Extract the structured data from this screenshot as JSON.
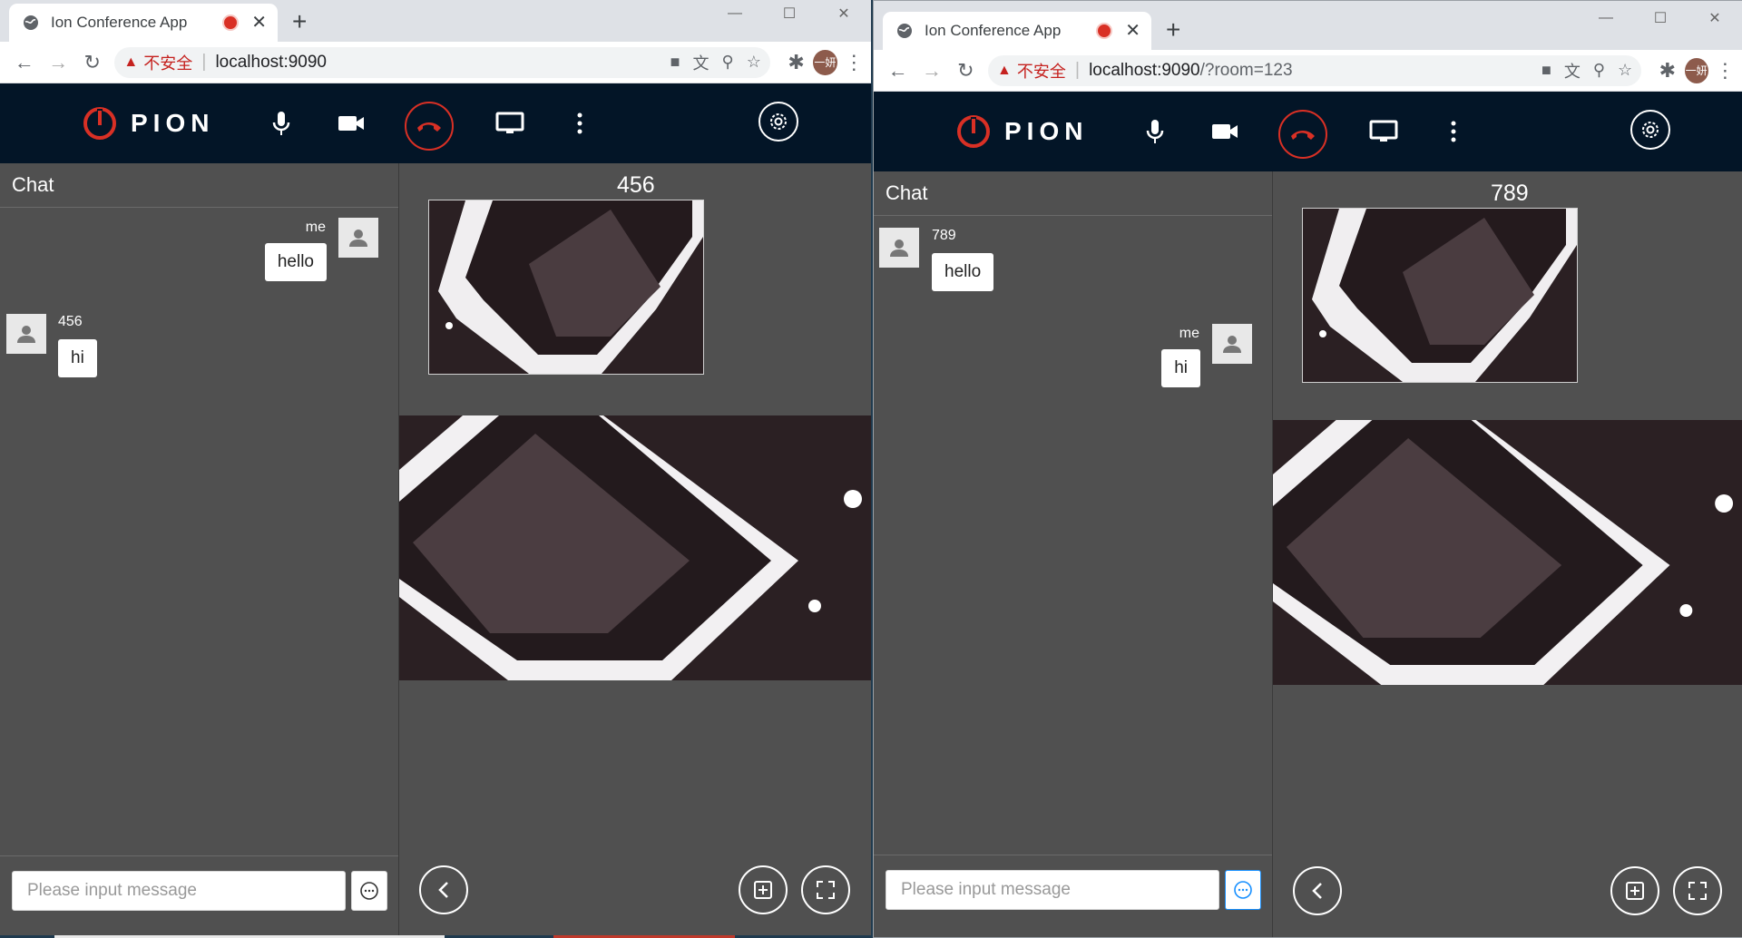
{
  "windows": [
    {
      "tab_title": "Ion Conference App",
      "insecure_label": "不安全",
      "url_host": "localhost:9090",
      "url_rest": "",
      "profile_label": "一妍",
      "brand": "PION",
      "chat": {
        "title": "Chat",
        "messages": [
          {
            "sender": "me",
            "text": "hello",
            "align": "right"
          },
          {
            "sender": "456",
            "text": "hi",
            "align": "left"
          }
        ],
        "input_placeholder": "Please input message"
      },
      "video": {
        "peer_name": "456"
      }
    },
    {
      "tab_title": "Ion Conference App",
      "insecure_label": "不安全",
      "url_host": "localhost:9090",
      "url_rest": "/?room=123",
      "profile_label": "一妍",
      "brand": "PION",
      "chat": {
        "title": "Chat",
        "messages": [
          {
            "sender": "789",
            "text": "hello",
            "align": "left"
          },
          {
            "sender": "me",
            "text": "hi",
            "align": "right"
          }
        ],
        "input_placeholder": "Please input message"
      },
      "video": {
        "peer_name": "789"
      }
    }
  ],
  "colors": {
    "app_header": "#031527",
    "app_body": "#505050",
    "accent_red": "#d93025",
    "accent_blue": "#1890ff"
  },
  "icons": [
    "globe-icon",
    "record-icon",
    "close-icon",
    "new-tab-icon",
    "back-icon",
    "forward-icon",
    "reload-icon",
    "warning-icon",
    "camera-icon",
    "translate-icon",
    "zoom-icon",
    "star-icon",
    "extensions-icon",
    "menu-icon",
    "pion-logo-icon",
    "mic-icon",
    "video-icon",
    "hangup-icon",
    "screen-share-icon",
    "more-icon",
    "settings-icon",
    "user-icon",
    "chat-send-icon",
    "collapse-icon",
    "add-icon",
    "fullscreen-icon"
  ]
}
